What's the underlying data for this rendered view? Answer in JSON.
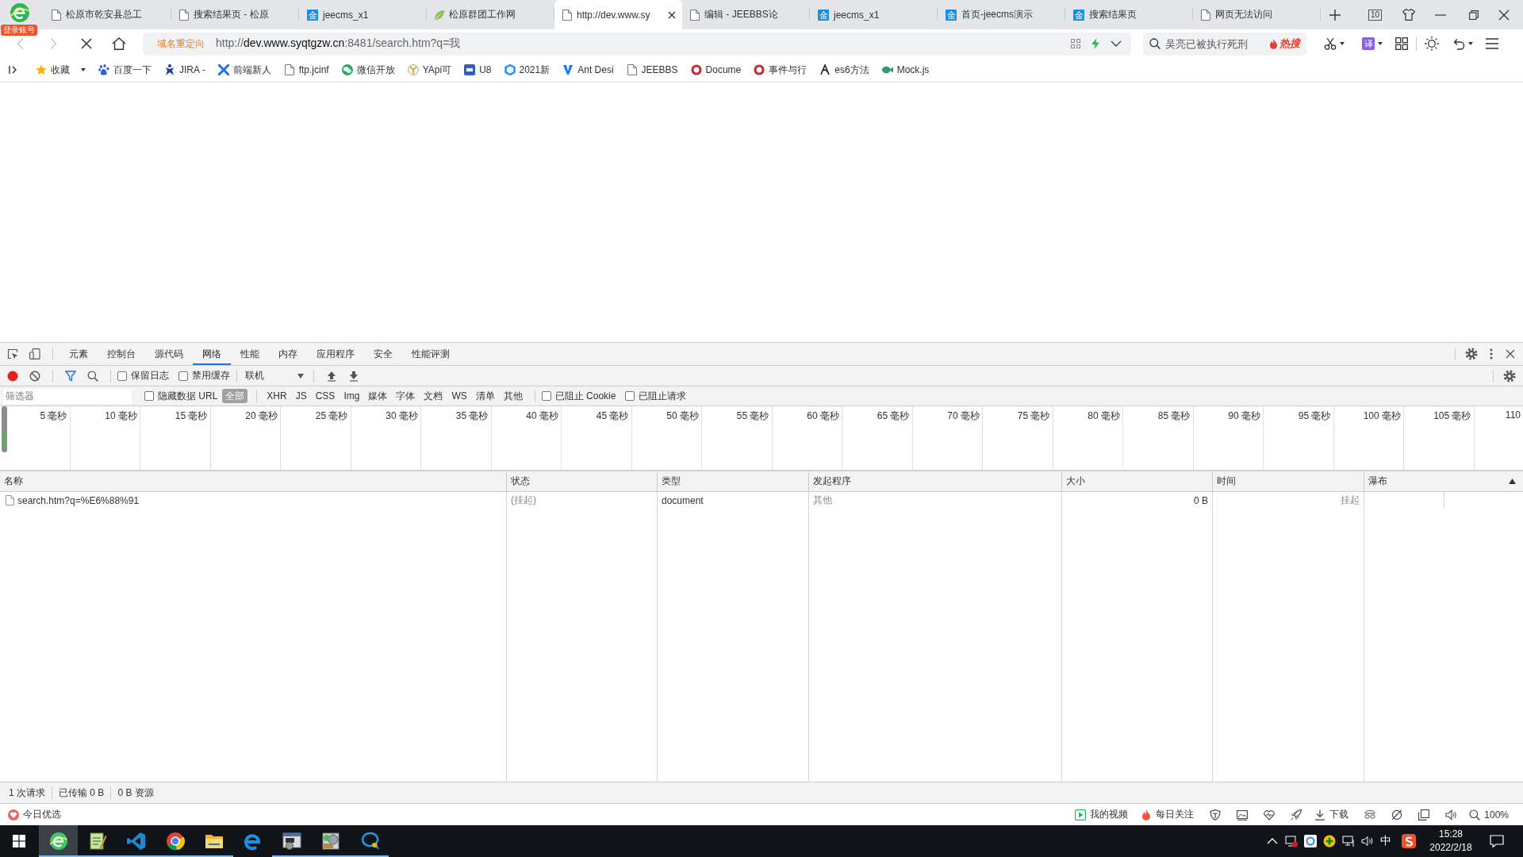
{
  "browser": {
    "account_badge": "登录账号",
    "tabs": [
      {
        "title": "松原市乾安县总工",
        "kind": "page",
        "selected": false
      },
      {
        "title": "搜索结果页 - 松原",
        "kind": "page",
        "selected": false
      },
      {
        "title": "jeecms_x1",
        "kind": "tile",
        "icon_text": "金",
        "selected": false
      },
      {
        "title": "松原群团工作网",
        "kind": "leaf",
        "selected": false
      },
      {
        "title": "http://dev.www.sy",
        "kind": "page",
        "selected": true
      },
      {
        "title": "编辑 - JEEBBS论",
        "kind": "page",
        "selected": false
      },
      {
        "title": "jeecms_x1",
        "kind": "tile",
        "icon_text": "金",
        "selected": false
      },
      {
        "title": "首页-jeecms演示",
        "kind": "tile",
        "icon_text": "金",
        "selected": false
      },
      {
        "title": "搜索结果页",
        "kind": "tile",
        "icon_text": "金",
        "selected": false
      },
      {
        "title": "网页无法访问",
        "kind": "page",
        "selected": false
      }
    ],
    "tab_count": "10",
    "navigation": {
      "back": {
        "disabled": true
      },
      "forward": {
        "disabled": true
      },
      "loading": true
    },
    "address_bar": {
      "redirect_label": "域名重定向",
      "url": {
        "scheme": "http://",
        "host": "dev.www.syqtgzw.cn",
        "path": ":8481/search.htm?q=我"
      }
    },
    "search": {
      "placeholder": "吴亮已被执行死刑",
      "hot_label": "热搜"
    },
    "translate_icon_text": "译",
    "bookmarks": [
      {
        "kind": "star",
        "label": "收藏",
        "dropdown": true
      },
      {
        "kind": "paw",
        "label": "百度一下"
      },
      {
        "kind": "figure",
        "label": "JIRA -"
      },
      {
        "kind": "cross",
        "label": "前端新人"
      },
      {
        "kind": "page",
        "label": "ftp.jcinf"
      },
      {
        "kind": "chat",
        "label": "微信开放"
      },
      {
        "kind": "tripod",
        "label": "YApi可"
      },
      {
        "kind": "tile",
        "label": "U8"
      },
      {
        "kind": "hexagon",
        "label": "2021新"
      },
      {
        "kind": "vshape",
        "label": "Ant Desi"
      },
      {
        "kind": "page",
        "label": "JEEBBS"
      },
      {
        "kind": "ring",
        "label": "Docume"
      },
      {
        "kind": "ring",
        "label": "事件与行"
      },
      {
        "kind": "swirl",
        "label": "es6方法"
      },
      {
        "kind": "blob",
        "label": "Mock.js"
      }
    ]
  },
  "devtools": {
    "tabs": [
      {
        "label": "元素",
        "selected": false
      },
      {
        "label": "控制台",
        "selected": false
      },
      {
        "label": "源代码",
        "selected": false
      },
      {
        "label": "网络",
        "selected": true
      },
      {
        "label": "性能",
        "selected": false
      },
      {
        "label": "内存",
        "selected": false
      },
      {
        "label": "应用程序",
        "selected": false
      },
      {
        "label": "安全",
        "selected": false
      },
      {
        "label": "性能评测",
        "selected": false
      }
    ],
    "toolbar": {
      "recording": true,
      "preserve_log": {
        "label": "保留日志",
        "checked": false
      },
      "disable_cache": {
        "label": "禁用缓存",
        "checked": false
      },
      "throttling": "联机"
    },
    "filter": {
      "placeholder": "筛选器",
      "hide_data_urls": {
        "label": "隐藏数据 URL",
        "checked": false
      },
      "types": [
        {
          "label": "全部",
          "selected": true
        },
        {
          "label": "XHR",
          "selected": false
        },
        {
          "label": "JS",
          "selected": false
        },
        {
          "label": "CSS",
          "selected": false
        },
        {
          "label": "Img",
          "selected": false
        },
        {
          "label": "媒体",
          "selected": false
        },
        {
          "label": "字体",
          "selected": false
        },
        {
          "label": "文档",
          "selected": false
        },
        {
          "label": "WS",
          "selected": false
        },
        {
          "label": "清单",
          "selected": false
        },
        {
          "label": "其他",
          "selected": false
        }
      ],
      "blocked_cookies": {
        "label": "已阻止 Cookie",
        "checked": false
      },
      "blocked_requests": {
        "label": "已阻止请求",
        "checked": false
      }
    },
    "overview": {
      "ticks": [
        "5 毫秒",
        "10 毫秒",
        "15 毫秒",
        "20 毫秒",
        "25 毫秒",
        "30 毫秒",
        "35 毫秒",
        "40 毫秒",
        "45 毫秒",
        "50 毫秒",
        "55 毫秒",
        "60 毫秒",
        "65 毫秒",
        "70 毫秒",
        "75 毫秒",
        "80 毫秒",
        "85 毫秒",
        "90 毫秒",
        "95 毫秒",
        "100 毫秒",
        "105 毫秒",
        "110"
      ]
    },
    "table": {
      "columns": [
        {
          "label": "名称",
          "sorted": false
        },
        {
          "label": "状态",
          "sorted": false
        },
        {
          "label": "类型",
          "sorted": false
        },
        {
          "label": "发起程序",
          "sorted": false
        },
        {
          "label": "大小",
          "sorted": false
        },
        {
          "label": "时间",
          "sorted": false
        },
        {
          "label": "瀑布",
          "sorted": true
        }
      ],
      "rows": [
        {
          "cells": [
            {
              "text": "search.htm?q=%E6%88%91",
              "muted": false
            },
            {
              "text": "(挂起)",
              "muted": true
            },
            {
              "text": "document",
              "muted": false
            },
            {
              "text": "其他",
              "muted": true
            },
            {
              "text": "0 B",
              "muted": false
            },
            {
              "text": "挂起",
              "muted": true
            }
          ]
        }
      ]
    },
    "summary": [
      "1 次请求",
      "已传输 0 B",
      "0 B 资源"
    ]
  },
  "status_bar": {
    "left": {
      "kind": "heart",
      "label": "今日优选"
    },
    "right": [
      {
        "kind": "play",
        "label": "我的视频"
      },
      {
        "kind": "flame",
        "label": "每日关注"
      },
      {
        "kind": "shield"
      },
      {
        "kind": "image"
      },
      {
        "kind": "pulse"
      },
      {
        "kind": "rocket"
      },
      {
        "kind": "download",
        "label": "下载"
      },
      {
        "kind": "glasses"
      },
      {
        "kind": "slashcircle"
      },
      {
        "kind": "window"
      },
      {
        "kind": "speaker"
      },
      {
        "kind": "zoom",
        "label": "100%"
      }
    ]
  },
  "taskbar": {
    "apps": [
      {
        "kind": "ebrowser",
        "active": true,
        "running": true
      },
      {
        "kind": "notepad",
        "active": false,
        "running": true
      },
      {
        "kind": "bracket",
        "active": false,
        "running": true
      },
      {
        "kind": "segments",
        "active": false,
        "running": true
      },
      {
        "kind": "folder",
        "active": false,
        "running": true
      },
      {
        "kind": "swirl",
        "active": false,
        "running": false
      },
      {
        "kind": "wingear",
        "active": false,
        "running": true
      },
      {
        "kind": "discs",
        "active": false,
        "running": true
      },
      {
        "kind": "bubble",
        "active": false,
        "running": true
      }
    ],
    "tray": [
      {
        "kind": "chevron"
      },
      {
        "kind": "monitor"
      },
      {
        "kind": "cloud"
      },
      {
        "kind": "plus"
      },
      {
        "kind": "network"
      },
      {
        "kind": "speaker"
      }
    ],
    "ime": "中",
    "time": "15:28",
    "date": "2022/2/18"
  }
}
